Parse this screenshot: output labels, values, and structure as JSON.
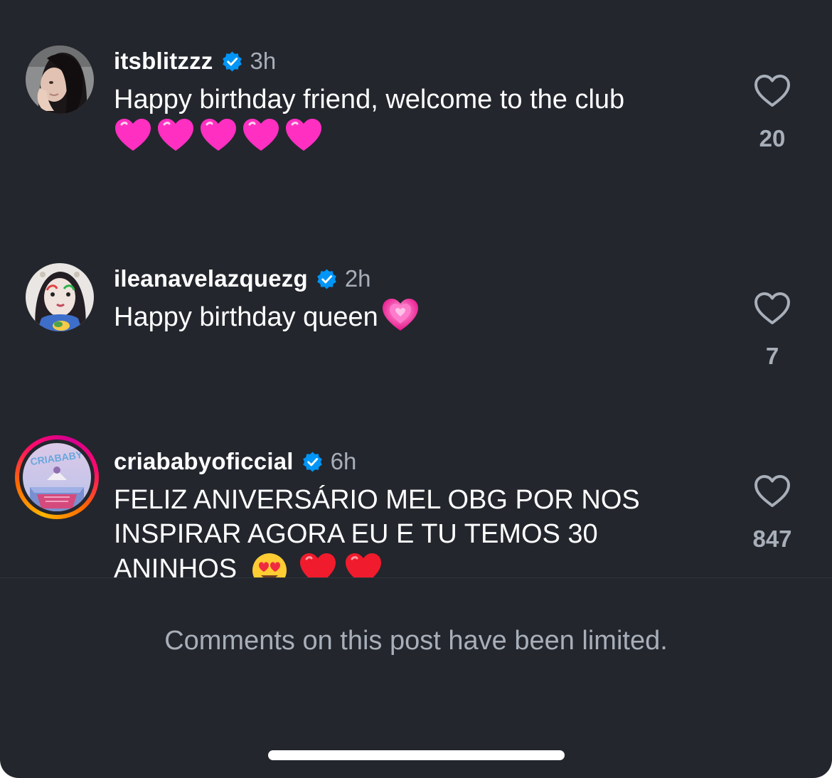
{
  "comments": [
    {
      "username": "itsblitzzz",
      "verified": true,
      "time": "3h",
      "text": "Happy birthday friend, welcome to the club",
      "emojis": [
        "pink-heart",
        "pink-heart",
        "pink-heart",
        "pink-heart",
        "pink-heart"
      ],
      "likes": "20"
    },
    {
      "username": "ileanavelazquezg",
      "verified": true,
      "time": "2h",
      "text": "Happy birthday queen",
      "emojis": [
        "sparkling-heart"
      ],
      "likes": "7"
    },
    {
      "username": "criababyoficcial",
      "verified": true,
      "time": "6h",
      "text_lines": [
        "FELIZ ANIVERSÁRIO MEL OBG POR NOS",
        "INSPIRAR AGORA EU E TU TEMOS 30",
        "ANINHOS"
      ],
      "emojis": [
        "heart-eyes-face",
        "red-heart",
        "red-heart"
      ],
      "likes": "847",
      "avatar_text": "CRIABABY"
    }
  ],
  "footer": {
    "limited_notice": "Comments on this post have been limited."
  },
  "colors": {
    "background": "#23262d",
    "verified_blue": "#0095f6",
    "secondary_text": "#a8afb9",
    "primary_text": "#ffffff"
  },
  "icons": {
    "verified": "verified-badge-icon",
    "like": "heart-outline-icon"
  }
}
